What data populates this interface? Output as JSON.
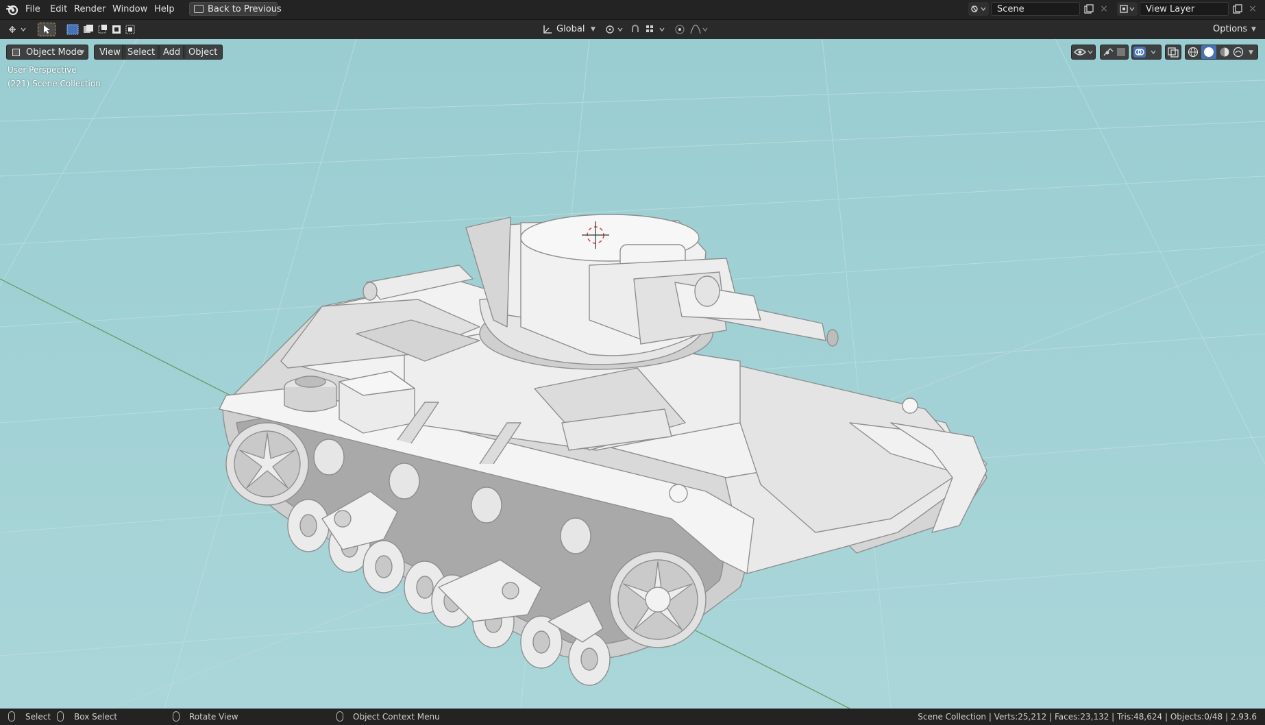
{
  "menubar": {
    "items": [
      "File",
      "Edit",
      "Render",
      "Window",
      "Help"
    ],
    "back_button": "Back to Previous",
    "scene_name": "Scene",
    "view_layer_name": "View Layer"
  },
  "header_toolbar": {
    "transform_orientation": "Global",
    "options_label": "Options"
  },
  "viewport": {
    "mode_label": "Object Mode",
    "menu": [
      "View",
      "Select",
      "Add",
      "Object"
    ],
    "overlay_text_1": "User Perspective",
    "overlay_text_2": "(221) Scene Collection",
    "background_color": "#a5d3d7",
    "model_color": "#e6e6e6"
  },
  "statusbar": {
    "left_items": [
      "Select",
      "Box Select",
      "Rotate View",
      "Object Context Menu"
    ],
    "stats": "Scene Collection | Verts:25,212 | Faces:23,132 | Tris:48,624 | Objects:0/48 | 2.93.6"
  },
  "icons": [
    "blender-logo-icon",
    "editor-type-icon",
    "select-cursor-icon",
    "select-box-icon",
    "scene-icon",
    "view-layer-icon",
    "new-icon",
    "close-icon",
    "orientation-icon",
    "pivot-icon",
    "snap-icon",
    "proportional-edit-icon",
    "visibility-icon",
    "gizmo-icon",
    "overlay-icon",
    "xray-icon",
    "wireframe-shading-icon",
    "solid-shading-icon",
    "material-shading-icon",
    "rendered-shading-icon",
    "mouse-left-icon",
    "mouse-middle-icon",
    "mouse-right-icon"
  ]
}
